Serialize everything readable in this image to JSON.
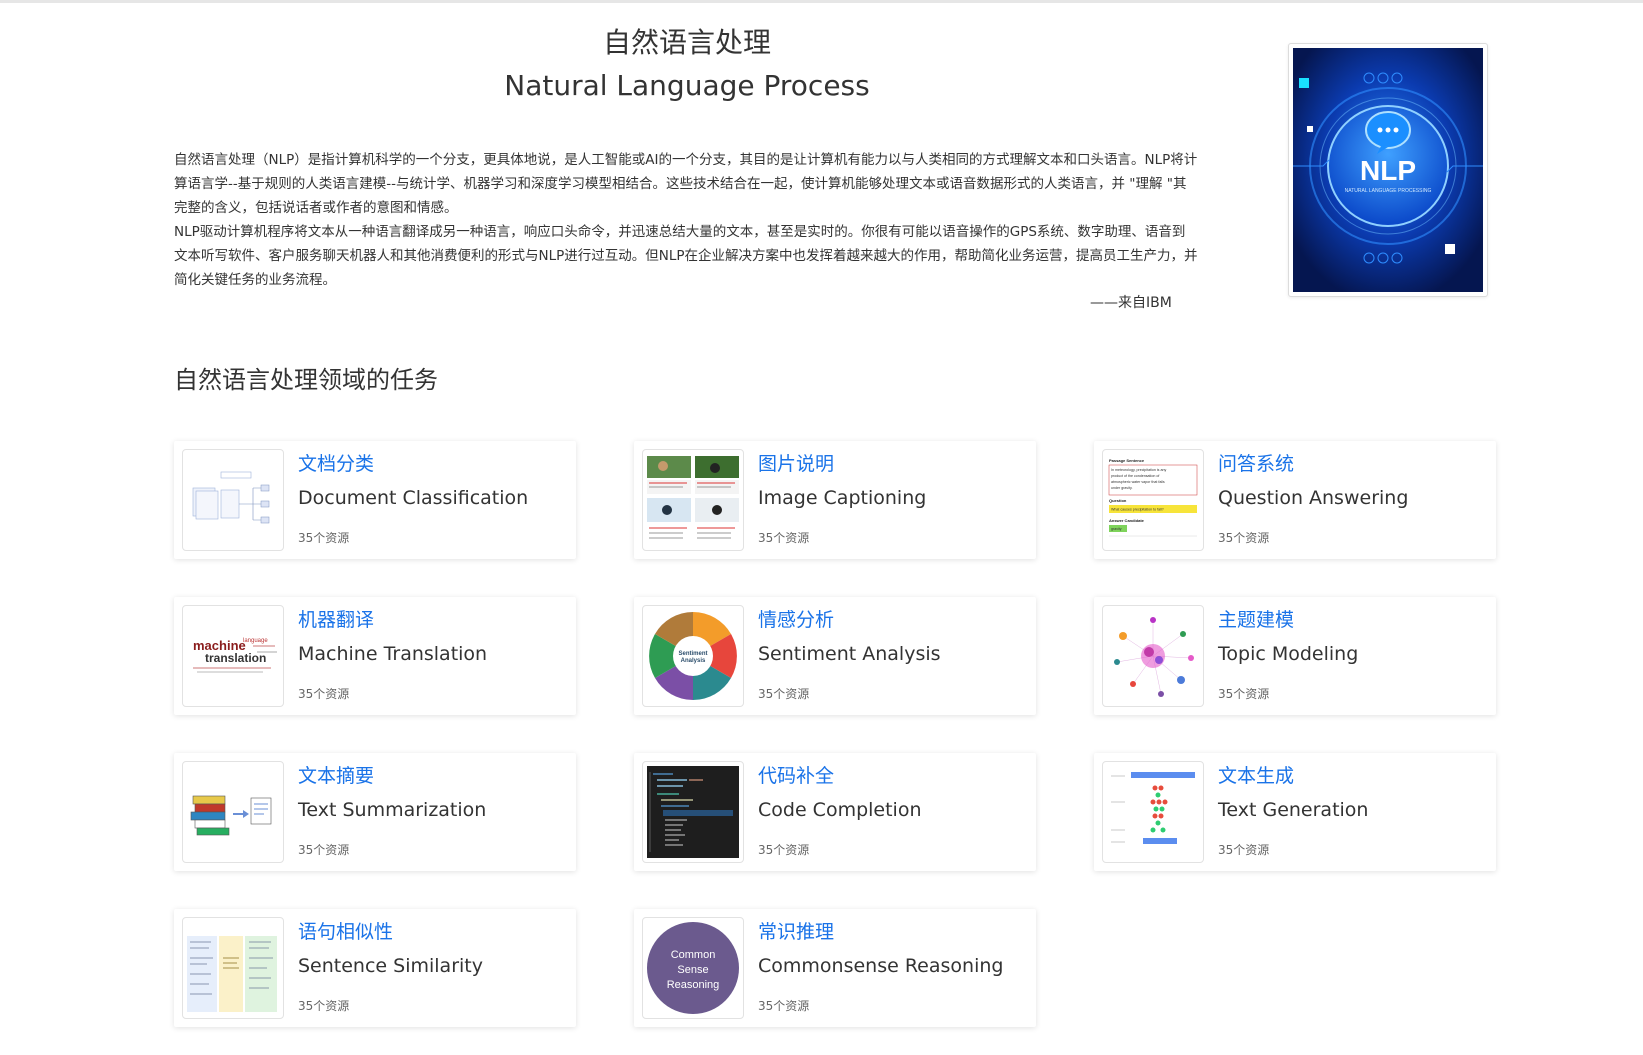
{
  "header": {
    "title_cn": "自然语言处理",
    "title_en": "Natural Language Process"
  },
  "intro": {
    "paragraph1": "自然语言处理（NLP）是指计算机科学的一个分支，更具体地说，是人工智能或AI的一个分支，其目的是让计算机有能力以与人类相同的方式理解文本和口头语言。NLP将计算语言学--基于规则的人类语言建模--与统计学、机器学习和深度学习模型相结合。这些技术结合在一起，使计算机能够处理文本或语音数据形式的人类语言，并 \"理解 \"其完整的含义，包括说话者或作者的意图和情感。",
    "paragraph2": "NLP驱动计算机程序将文本从一种语言翻译成另一种语言，响应口头命令，并迅速总结大量的文本，甚至是实时的。你很有可能以语音操作的GPS系统、数字助理、语音到文本听写软件、客户服务聊天机器人和其他消费便利的形式与NLP进行过互动。但NLP在企业解决方案中也发挥着越来越大的作用，帮助简化业务运营，提高员工生产力，并简化关键任务的业务流程。",
    "source": "——来自IBM"
  },
  "cover": {
    "title": "NLP",
    "subtitle": "NATURAL LANGUAGE PROCESSING",
    "icon": "chat-bubble-icon"
  },
  "section": {
    "title": "自然语言处理领域的任务"
  },
  "tasks": [
    {
      "cn": "文档分类",
      "en": "Document Classification",
      "count": "35个资源",
      "icon": "document-classification-thumbnail"
    },
    {
      "cn": "图片说明",
      "en": "Image Captioning",
      "count": "35个资源",
      "icon": "image-captioning-thumbnail"
    },
    {
      "cn": "问答系统",
      "en": "Question Answering",
      "count": "35个资源",
      "icon": "question-answering-thumbnail",
      "thumb_text": {
        "passage": "Passage Sentence",
        "p1": "In meteorology, precipitation is any",
        "p2": "product of the condensation of",
        "p3": "atmospheric water vapor that falls",
        "p4": "under gravity.",
        "question": "Question",
        "q": "What causes precipitation to fall?",
        "answer": "Answer Candidate",
        "a": "gravity"
      }
    },
    {
      "cn": "机器翻译",
      "en": "Machine Translation",
      "count": "35个资源",
      "icon": "machine-translation-thumbnail",
      "thumb_text": {
        "w1": "machine",
        "w2": "translation",
        "w3": "language"
      }
    },
    {
      "cn": "情感分析",
      "en": "Sentiment Analysis",
      "count": "35个资源",
      "icon": "sentiment-analysis-thumbnail",
      "thumb_text": {
        "center1": "Sentiment",
        "center2": "Analysis"
      }
    },
    {
      "cn": "主题建模",
      "en": "Topic Modeling",
      "count": "35个资源",
      "icon": "topic-modeling-thumbnail"
    },
    {
      "cn": "文本摘要",
      "en": "Text Summarization",
      "count": "35个资源",
      "icon": "text-summarization-thumbnail"
    },
    {
      "cn": "代码补全",
      "en": "Code Completion",
      "count": "35个资源",
      "icon": "code-completion-thumbnail"
    },
    {
      "cn": "文本生成",
      "en": "Text Generation",
      "count": "35个资源",
      "icon": "text-generation-thumbnail"
    },
    {
      "cn": "语句相似性",
      "en": "Sentence Similarity",
      "count": "35个资源",
      "icon": "sentence-similarity-thumbnail"
    },
    {
      "cn": "常识推理",
      "en": "Commonsense Reasoning",
      "count": "35个资源",
      "icon": "commonsense-reasoning-thumbnail",
      "thumb_text": {
        "l1": "Common",
        "l2": "Sense",
        "l3": "Reasoning"
      }
    }
  ],
  "colors": {
    "link": "#1a73e8",
    "text": "#333333",
    "muted": "#666666",
    "cover_bg": "#061a5c",
    "cover_glow": "#2b7fff"
  }
}
